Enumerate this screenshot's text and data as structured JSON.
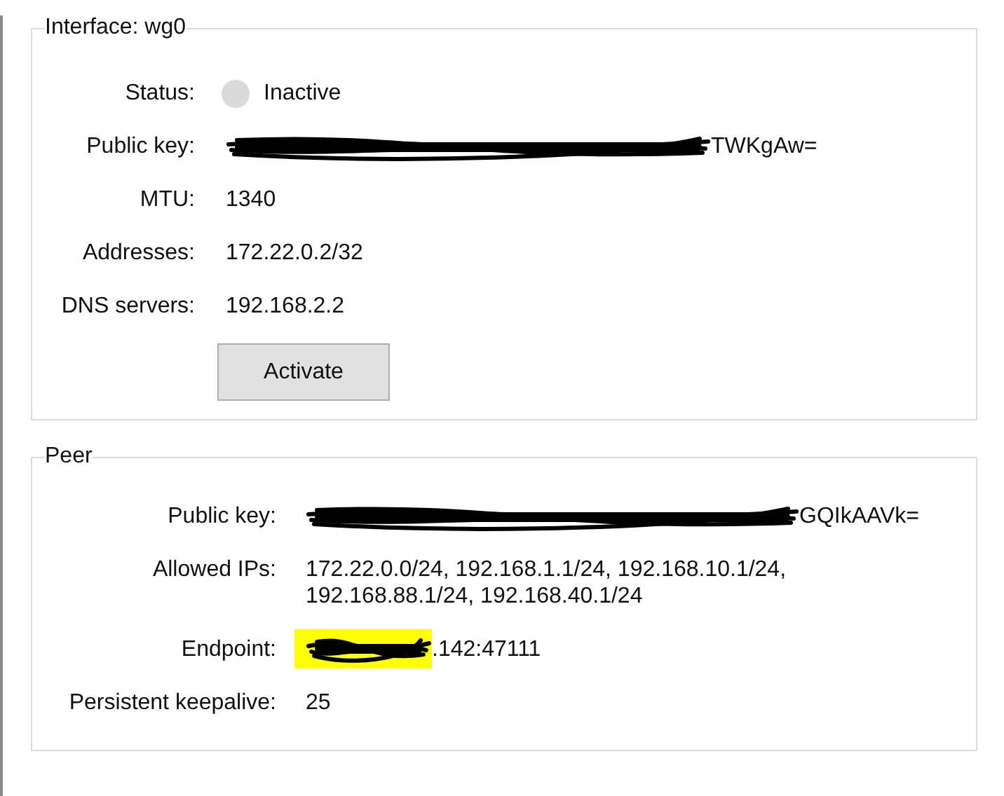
{
  "interface": {
    "title": "Interface: wg0",
    "rows": [
      {
        "kind": "status",
        "label": "Status:",
        "value": "Inactive",
        "active": false
      },
      {
        "kind": "text",
        "label": "Public key:",
        "value": "TWKgAw=",
        "redacted": true
      },
      {
        "kind": "text",
        "label": "MTU:",
        "value": "1340"
      },
      {
        "kind": "text",
        "label": "Addresses:",
        "value": "172.22.0.2/32"
      },
      {
        "kind": "text",
        "label": "DNS servers:",
        "value": "192.168.2.2"
      }
    ],
    "button": "Activate"
  },
  "peer": {
    "title": "Peer",
    "rows": [
      {
        "kind": "text",
        "label": "Public key:",
        "value": "GQIkAAVk=",
        "redacted": true
      },
      {
        "kind": "text",
        "label": "Allowed IPs:",
        "value": "172.22.0.0/24, 192.168.1.1/24, 192.168.10.1/24, 192.168.88.1/24, 192.168.40.1/24"
      },
      {
        "kind": "text",
        "label": "Endpoint:",
        "value": ".142:47111",
        "redacted": true,
        "highlighted": true
      },
      {
        "kind": "text",
        "label": "Persistent keepalive:",
        "value": "25"
      }
    ]
  }
}
